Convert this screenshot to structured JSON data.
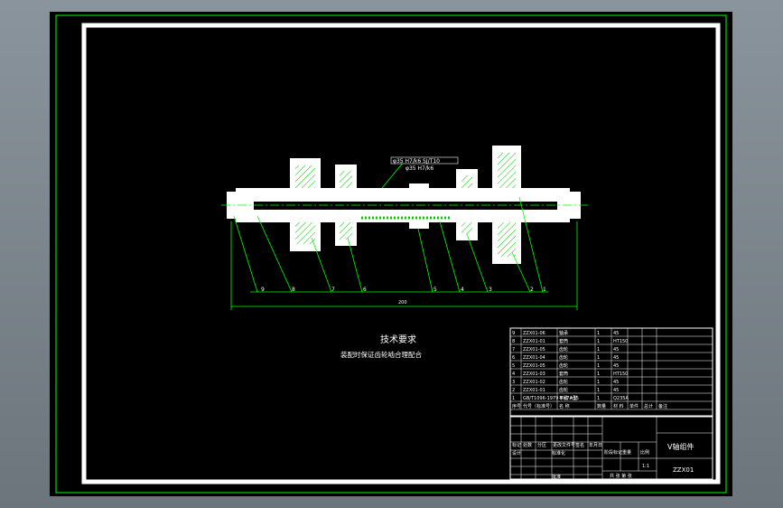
{
  "notes": {
    "title": "技术要求",
    "body": "装配时保证齿轮啮合理配合"
  },
  "callout": {
    "line1": "φ35 H7/k6 SJ/T10",
    "line2": "φ35 H7/k6"
  },
  "dimension": {
    "overall_length": "200"
  },
  "balloons": [
    "9",
    "8",
    "7",
    "6",
    "5",
    "4",
    "3",
    "2",
    "1"
  ],
  "parts_list": {
    "rows": [
      {
        "no": "9",
        "code": "ZZX01-06",
        "name": "轴承",
        "qty": "1",
        "material": "45"
      },
      {
        "no": "8",
        "code": "ZZX01-01",
        "name": "套筒",
        "qty": "1",
        "material": "HT150"
      },
      {
        "no": "7",
        "code": "ZZX01-05",
        "name": "齿轮",
        "qty": "1",
        "material": "45"
      },
      {
        "no": "6",
        "code": "ZZX01-04",
        "name": "齿轮",
        "qty": "1",
        "material": "45"
      },
      {
        "no": "5",
        "code": "ZZX01-05",
        "name": "齿轮",
        "qty": "1",
        "material": "45"
      },
      {
        "no": "4",
        "code": "ZZX01-03",
        "name": "套筒",
        "qty": "1",
        "material": "HT150"
      },
      {
        "no": "3",
        "code": "ZZX01-02",
        "name": "齿轮",
        "qty": "1",
        "material": "45"
      },
      {
        "no": "2",
        "code": "ZZX01-01",
        "name": "齿轮",
        "qty": "1",
        "material": "45"
      },
      {
        "no": "1",
        "code": "GB/T1096-1979 8×7×35",
        "name": "平键 A型",
        "qty": "1",
        "material": "Q235A"
      }
    ],
    "header": {
      "no": "序号",
      "code": "代号（标准号）",
      "name": "名 称",
      "qty": "数量",
      "material": "材 料",
      "unit_wt": "单件",
      "total_wt": "总计",
      "remark": "备注"
    }
  },
  "title_block": {
    "name": "V轴组件",
    "drawing_no": "ZZX01",
    "labels": [
      "标记",
      "处数",
      "分区",
      "更改文件号",
      "签名",
      "年月日"
    ],
    "design": "设计",
    "standard": "标准化",
    "stage": "阶段标记",
    "weight": "重量",
    "scale": "比例",
    "scale_value": "1:1",
    "sheet_info": "共 张 第 张",
    "approve": "批准"
  },
  "colors": {
    "frame": "#00ff00",
    "outline": "#ffffff",
    "background": "#000000",
    "hatch": "#00cc00"
  }
}
